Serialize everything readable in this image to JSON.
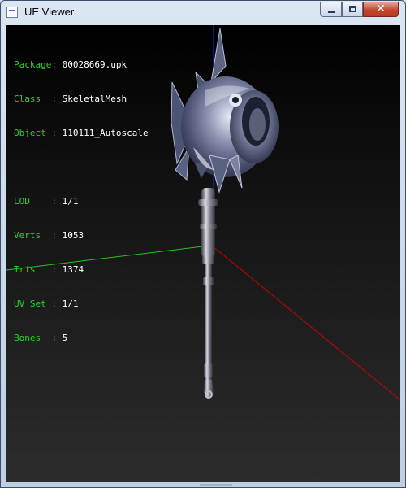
{
  "window": {
    "title": "UE Viewer",
    "close_glyph": "✕"
  },
  "info": {
    "package": {
      "label": "Package: ",
      "value": "00028669.upk"
    },
    "class": {
      "label": "Class  : ",
      "value": "SkeletalMesh"
    },
    "object": {
      "label": "Object : ",
      "value": "110111_Autoscale"
    },
    "lod": {
      "label": "LOD    : ",
      "value": "1/1"
    },
    "verts": {
      "label": "Verts  : ",
      "value": "1053"
    },
    "tris": {
      "label": "Tris   : ",
      "value": "1374"
    },
    "uvset": {
      "label": "UV Set : ",
      "value": "1/1"
    },
    "bones": {
      "label": "Bones  : ",
      "value": "5"
    }
  },
  "colors": {
    "label_green": "#22d622",
    "axis_x": "#cc0000",
    "axis_y": "#22c422",
    "axis_z": "#2020ff"
  },
  "icons": [
    "app-icon",
    "minimize-icon",
    "maximize-icon",
    "close-icon"
  ]
}
